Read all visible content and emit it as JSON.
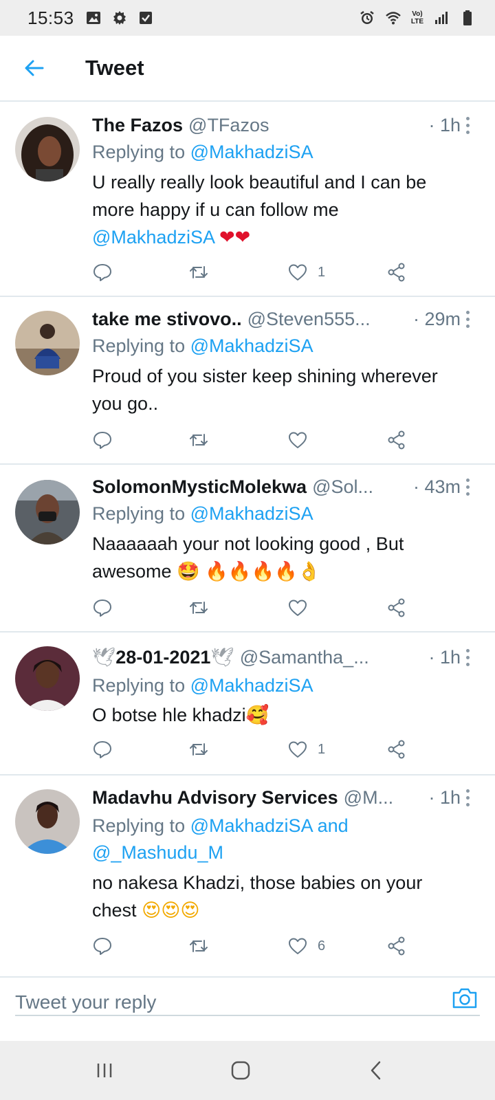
{
  "status_bar": {
    "time": "15:53",
    "left_icons": [
      "image-icon",
      "gear-icon",
      "checkbox-icon"
    ],
    "right_icons": [
      "alarm-icon",
      "wifi-icon",
      "volte-icon",
      "signal-icon",
      "battery-icon"
    ],
    "volte_top": "Vo)",
    "volte_bottom": "LTE"
  },
  "header": {
    "title": "Tweet",
    "accent": "#1da1f2"
  },
  "tweets": [
    {
      "name": "The Fazos",
      "handle": "@TFazos",
      "time": "· 1h",
      "replying_prefix": "Replying to ",
      "replying_to": "@MakhadziSA",
      "replying_and": "",
      "replying_to2": "",
      "text_line1": "U really really look beautiful and I can be",
      "text_line2": "more happy if u can follow me",
      "text_mention": "@MakhadziSA",
      "text_emoji": "❤❤",
      "likes": "1"
    },
    {
      "name": "take me stivovo..",
      "handle": "@Steven555...",
      "time": "· 29m",
      "replying_prefix": "Replying to ",
      "replying_to": "@MakhadziSA",
      "text_line1": "Proud of you sister keep shining wherever",
      "text_line2": "you go..",
      "likes": ""
    },
    {
      "name": "SolomonMysticMolekwa",
      "handle": "@Sol...",
      "time": "· 43m",
      "replying_prefix": "Replying to ",
      "replying_to": "@MakhadziSA",
      "text_line1": "Naaaaaah your not looking good , But",
      "text_line2": "awesome",
      "text_emoji_star": "🤩",
      "text_emoji_fire": "🔥🔥🔥🔥",
      "text_emoji_ok": "👌",
      "likes": ""
    },
    {
      "name_emoji_left": "🕊",
      "name": "28-01-2021",
      "name_emoji_right": "🕊",
      "handle": "@Samantha_...",
      "time": "· 1h",
      "replying_prefix": "Replying to ",
      "replying_to": "@MakhadziSA",
      "text_line1": "O botse hle khadzi",
      "text_emoji": "🥰",
      "likes": "1"
    },
    {
      "name": "Madavhu Advisory Services",
      "handle": "@M...",
      "time": "· 1h",
      "replying_prefix": "Replying to ",
      "replying_to": "@MakhadziSA",
      "replying_and": " and",
      "replying_to2": "@_Mashudu_M",
      "text_line1": "no nakesa Khadzi, those babies on your",
      "text_line2": "chest",
      "text_emoji": "😍😍😍",
      "likes": "6"
    }
  ],
  "reply": {
    "placeholder": "Tweet your reply"
  },
  "nav": {
    "buttons": [
      "recent-apps-icon",
      "home-icon",
      "back-icon"
    ]
  }
}
